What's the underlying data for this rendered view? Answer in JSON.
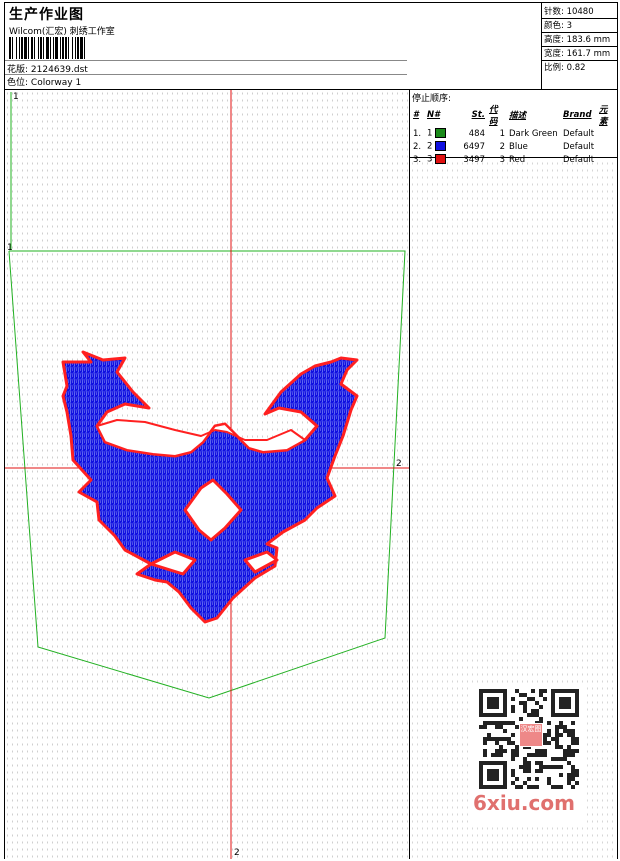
{
  "header": {
    "title": "生产作业图",
    "subtitle": "Wilcom(汇宏) 刺绣工作室",
    "design_label": "花版:",
    "design_value": "2124639.dst",
    "colorway_label": "色位:",
    "colorway_value": "Colorway 1"
  },
  "stats": [
    {
      "label": "针数:",
      "value": "10480"
    },
    {
      "label": "颜色:",
      "value": "3"
    },
    {
      "label": "高度:",
      "value": "183.6 mm"
    },
    {
      "label": "宽度:",
      "value": "161.7 mm"
    },
    {
      "label": "比例:",
      "value": "0.82"
    }
  ],
  "stop_sequence": {
    "title": "停止顺序:",
    "columns": [
      "#",
      "N#",
      "St.",
      "代码",
      "描述",
      "Brand",
      "元素"
    ],
    "rows": [
      {
        "idx": "1.",
        "n": "1",
        "stitches": "484",
        "code": "1",
        "desc": "Dark Green",
        "brand": "Default",
        "color": "#1a8a1a"
      },
      {
        "idx": "2.",
        "n": "2",
        "stitches": "6497",
        "code": "2",
        "desc": "Blue",
        "brand": "Default",
        "color": "#1010e0"
      },
      {
        "idx": "3.",
        "n": "3",
        "stitches": "3497",
        "code": "3",
        "desc": "Red",
        "brand": "Default",
        "color": "#e01010"
      }
    ]
  },
  "axis_labels": {
    "top_left": "1",
    "left_mid": "1",
    "right_mid": "2",
    "bottom": "2"
  },
  "watermark": {
    "text": "6xiu.com",
    "badge": "汉宏图"
  },
  "colors": {
    "outline_green": "#22b022",
    "crosshair_red": "#e01010",
    "fill_blue": "#1010e0",
    "border_red": "#ff2020"
  }
}
